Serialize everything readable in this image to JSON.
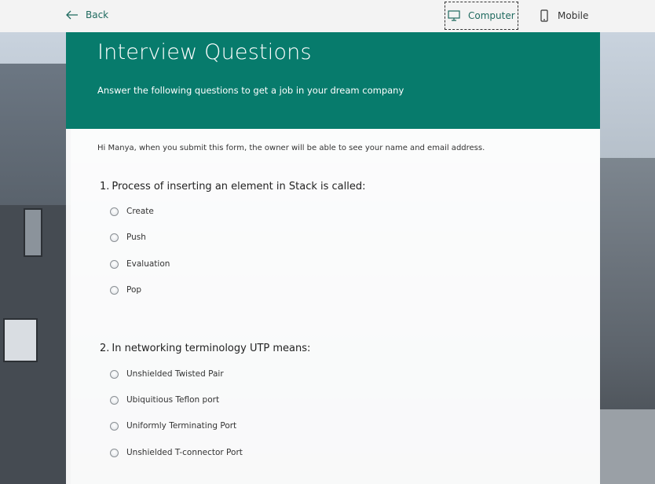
{
  "topbar": {
    "back_label": "Back",
    "view_computer_label": "Computer",
    "view_mobile_label": "Mobile"
  },
  "form": {
    "title": "Interview Questions",
    "subtitle": "Answer the following questions to get a job in your dream company",
    "notice": "Hi Manya, when you submit this form, the owner will be able to see your name and email address.",
    "questions": [
      {
        "number": "1.",
        "text": "Process of inserting an element in Stack is called:",
        "options": [
          "Create",
          "Push",
          "Evaluation",
          "Pop"
        ]
      },
      {
        "number": "2.",
        "text": "In networking terminology UTP means:",
        "options": [
          "Unshielded Twisted Pair",
          "Ubiquitious Teflon port",
          "Uniformly Terminating Port",
          "Unshielded T-connector Port"
        ]
      }
    ]
  },
  "colors": {
    "header_bg": "#077b6c",
    "accent": "#1f6a5f"
  }
}
